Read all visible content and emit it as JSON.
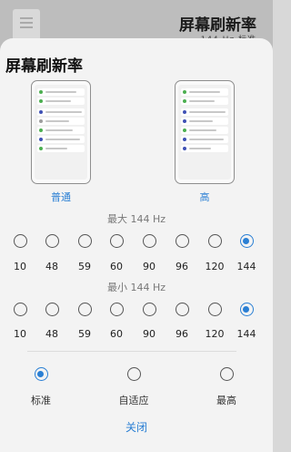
{
  "background": {
    "title": "屏幕刷新率",
    "subtitle": "144 Hz  标准"
  },
  "sheet": {
    "title": "屏幕刷新率",
    "presets": [
      {
        "label": "普通"
      },
      {
        "label": "高"
      }
    ],
    "max": {
      "label": "最大 144 Hz",
      "options": [
        "10",
        "48",
        "59",
        "60",
        "90",
        "96",
        "120",
        "144"
      ],
      "selected": "144"
    },
    "min": {
      "label": "最小 144 Hz",
      "options": [
        "10",
        "48",
        "59",
        "60",
        "90",
        "96",
        "120",
        "144"
      ],
      "selected": "144"
    },
    "modes": {
      "options": [
        "标准",
        "自适应",
        "最高"
      ],
      "selected": "标准"
    },
    "close_label": "关闭"
  },
  "colors": {
    "accent": "#2a7fd4",
    "sheet_bg": "#f3f3f3",
    "scrim": "#bdbdbd"
  },
  "preview_rows": {
    "left": [
      "#4caf50",
      "#4caf50",
      "#3f51b5",
      "#9e9e9e",
      "#4caf50",
      "#3f51b5",
      "#4caf50"
    ],
    "right": [
      "#4caf50",
      "#4caf50",
      "#3f51b5",
      "#3f51b5",
      "#4caf50",
      "#3f51b5",
      "#3f51b5"
    ]
  }
}
